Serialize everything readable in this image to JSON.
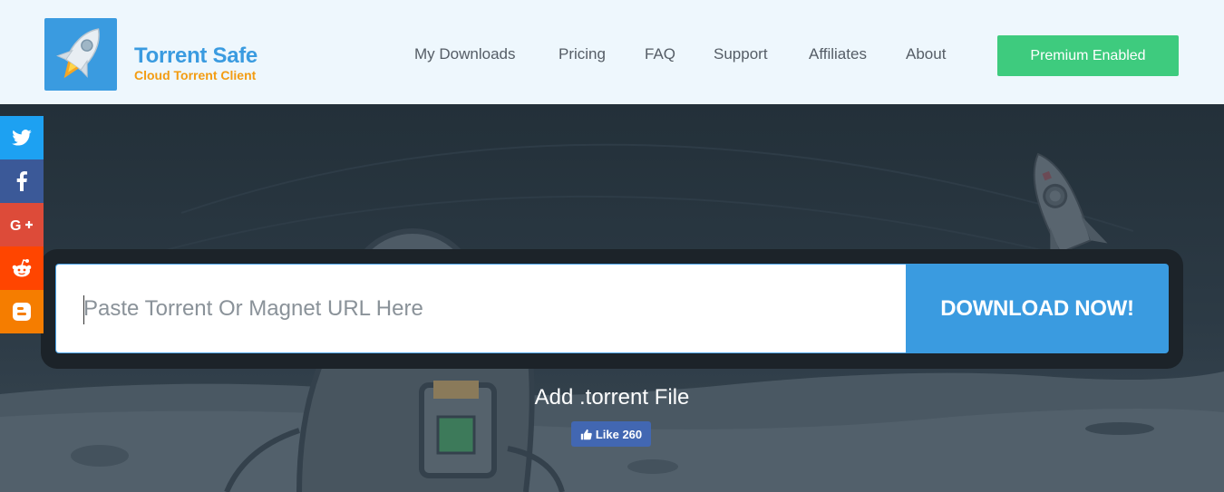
{
  "brand": {
    "title": "Torrent Safe",
    "subtitle": "Cloud Torrent Client",
    "logo_icon": "rocket-icon"
  },
  "nav": {
    "items": [
      {
        "label": "My Downloads"
      },
      {
        "label": "Pricing"
      },
      {
        "label": "FAQ"
      },
      {
        "label": "Support"
      },
      {
        "label": "Affiliates"
      },
      {
        "label": "About"
      }
    ],
    "premium_label": "Premium Enabled"
  },
  "social": {
    "icons": [
      "twitter-icon",
      "facebook-icon",
      "google-plus-icon",
      "reddit-icon",
      "blogger-icon"
    ]
  },
  "search": {
    "placeholder": "Paste Torrent Or Magnet URL Here",
    "value": "",
    "button_label": "DOWNLOAD NOW!"
  },
  "add_torrent_label": "Add .torrent File",
  "like": {
    "label": "Like 260"
  },
  "colors": {
    "accent": "#3a9be0",
    "premium": "#3ecb7e",
    "brand_orange": "#f39c12",
    "header_bg": "#eef7fd",
    "hero_bg": "#2a3640"
  }
}
